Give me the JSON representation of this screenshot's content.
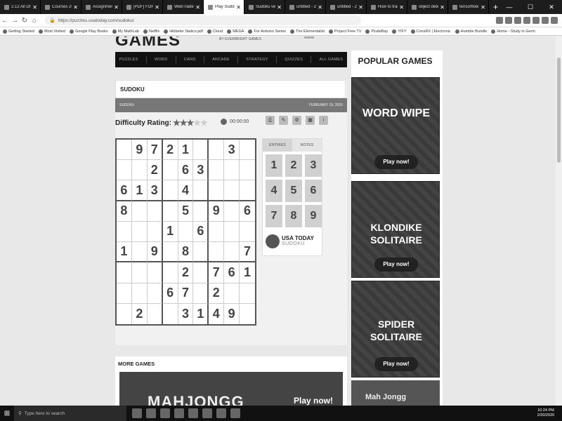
{
  "browser": {
    "tabs": [
      {
        "label": "2.12 All Draft"
      },
      {
        "label": "Courses 2020"
      },
      {
        "label": "Assignment 5"
      },
      {
        "label": "[PDF] FORECA"
      },
      {
        "label": "WebTrader"
      },
      {
        "label": "Play Sudoku"
      },
      {
        "label": "Sudoku very d"
      },
      {
        "label": "untitled - 2020"
      },
      {
        "label": "untitled - 2020"
      },
      {
        "label": "How to train"
      },
      {
        "label": "object detecti"
      },
      {
        "label": "tensorflow"
      }
    ],
    "active_tab": 5,
    "url": "https://puzzles.usatoday.com/sudoku/",
    "bookmarks": [
      "Getting Started",
      "Most Visited",
      "Google Play Books",
      "My MathLab",
      "Netflix",
      "Hibbeler Statics.pdf",
      "Cloud",
      "MEGA",
      "For Arduino Series",
      "The Elementalist",
      "Project Free TV",
      "PirateBay",
      "YIFY",
      "ConsRX | Electronic",
      "Humble Bundle",
      "Home - Study in Germ"
    ]
  },
  "site": {
    "logo": "GAMES",
    "tagline": "BY EVERBRIGHT GAMES",
    "nav": [
      "PUZZLES",
      "WORD",
      "CARD",
      "ARCADE",
      "STRATEGY",
      "QUIZZES",
      "ALL GAMES"
    ]
  },
  "game": {
    "title": "SUDOKU",
    "sub_left": "SUDOKU",
    "date": "FEBRUARY 19, 2020",
    "difficulty_label": "Difficulty Rating:",
    "stars_on": "★★★",
    "stars_off": "★★",
    "difficulty_rating": 3,
    "difficulty_max": 5,
    "timer": "00:00:00",
    "tools": [
      "print",
      "notes",
      "settings",
      "grid",
      "info"
    ],
    "grid": [
      [
        "",
        "9",
        "7",
        "2",
        "1",
        "",
        "",
        "3",
        ""
      ],
      [
        "",
        "",
        "2",
        "",
        "6",
        "3",
        "",
        "",
        ""
      ],
      [
        "6",
        "1",
        "3",
        "",
        "4",
        "",
        "",
        "",
        ""
      ],
      [
        "8",
        "",
        "",
        "",
        "5",
        "",
        "9",
        "",
        "6"
      ],
      [
        "",
        "",
        "",
        "1",
        "",
        "6",
        "",
        "",
        ""
      ],
      [
        "1",
        "",
        "9",
        "",
        "8",
        "",
        "",
        "",
        "7"
      ],
      [
        "",
        "",
        "",
        "",
        "2",
        "",
        "7",
        "6",
        "1"
      ],
      [
        "",
        "",
        "",
        "6",
        "7",
        "",
        "2",
        "",
        ""
      ],
      [
        "",
        "2",
        "",
        "",
        "3",
        "1",
        "4",
        "9",
        ""
      ]
    ],
    "entry_tabs": [
      "ENTRIES",
      "NOTES"
    ],
    "numbers": [
      "1",
      "2",
      "3",
      "4",
      "5",
      "6",
      "7",
      "8",
      "9"
    ],
    "brand_name": "USA TODAY",
    "brand_sub": "SUDOKU"
  },
  "more_games": {
    "heading": "MORE GAMES",
    "feature": "MAHJONGG",
    "play": "Play now!"
  },
  "sidebar": {
    "heading": "POPULAR GAMES",
    "promos": [
      {
        "name": "WORD WIPE",
        "play": "Play now!"
      },
      {
        "name": "KLONDIKE SOLITAIRE",
        "play": "Play now!"
      },
      {
        "name": "SPIDER SOLITAIRE",
        "play": "Play now!"
      }
    ],
    "last": "Mah Jongg"
  },
  "taskbar": {
    "search_placeholder": "Type here to search",
    "time": "10:24 PM",
    "date": "2/20/2020"
  }
}
